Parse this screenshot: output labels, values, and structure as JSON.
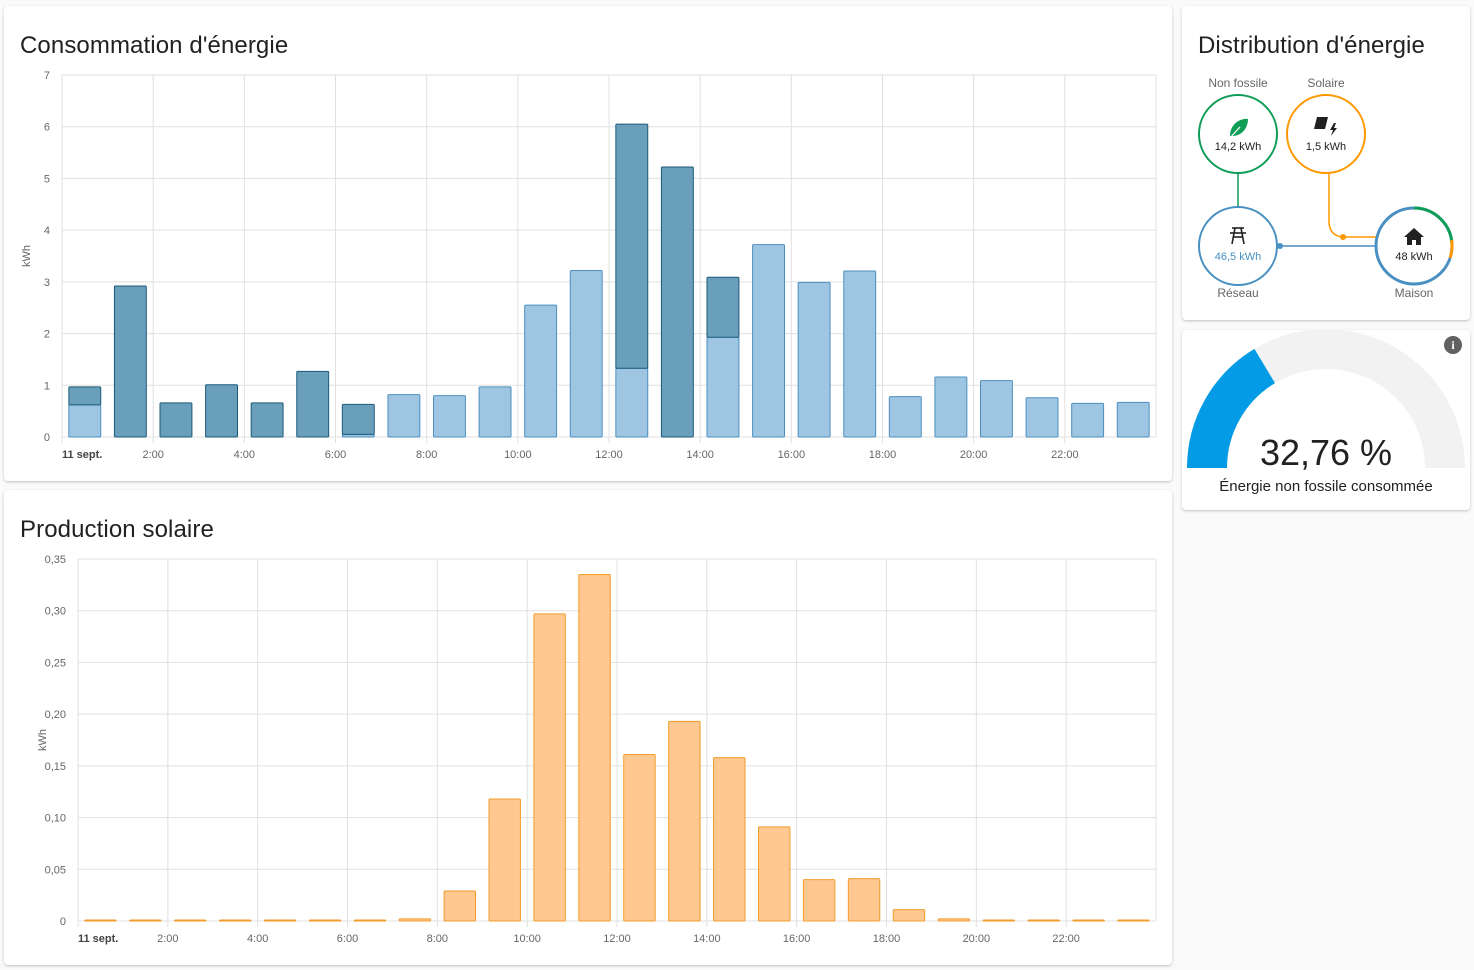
{
  "consumption_card": {
    "title": "Consommation d'énergie",
    "unit": "kWh"
  },
  "solar_card": {
    "title": "Production solaire",
    "unit": "kWh"
  },
  "distribution_card": {
    "title": "Distribution d'énergie",
    "non_fossil": {
      "label": "Non fossile",
      "value": "14,2 kWh"
    },
    "solar": {
      "label": "Solaire",
      "value": "1,5 kWh"
    },
    "grid": {
      "label": "Réseau",
      "value": "46,5 kWh"
    },
    "home": {
      "label": "Maison",
      "value": "48 kWh"
    }
  },
  "gauge_card": {
    "value": 32.76,
    "value_text": "32,76 %",
    "label": "Énergie non fossile consommée",
    "info_icon": "info-icon"
  },
  "colors": {
    "grid_dark": "#6a9fbb",
    "grid_dark_border": "#1d5a7a",
    "grid_light": "#9ec6e2",
    "grid_light_border": "#4d8fc0",
    "solar_fill": "#ffc890",
    "solar_border": "#f39c2c",
    "non_fossil": "#0f9d58",
    "solar_node": "#ff9800",
    "grid_node": "#488fc2",
    "gauge": "#039be5"
  },
  "chart_data": [
    {
      "type": "bar",
      "title": "Consommation d'énergie",
      "ylabel": "kWh",
      "ylim": [
        0,
        7
      ],
      "yticks": [
        "0",
        "1",
        "2",
        "3",
        "4",
        "5",
        "6",
        "7"
      ],
      "xticks": [
        "11 sept.",
        "2:00",
        "4:00",
        "6:00",
        "8:00",
        "10:00",
        "12:00",
        "14:00",
        "16:00",
        "18:00",
        "20:00",
        "22:00"
      ],
      "categories": [
        "0:00",
        "1:00",
        "2:00",
        "3:00",
        "4:00",
        "5:00",
        "6:00",
        "7:00",
        "8:00",
        "9:00",
        "10:00",
        "11:00",
        "12:00",
        "13:00",
        "14:00",
        "15:00",
        "16:00",
        "17:00",
        "18:00",
        "19:00",
        "20:00",
        "21:00",
        "22:00",
        "23:00"
      ],
      "series": [
        {
          "values": [
            0.62,
            0,
            0,
            0,
            0,
            0,
            0.05,
            0.82,
            0.8,
            0.97,
            2.55,
            3.22,
            1.33,
            0,
            1.93,
            3.72,
            2.99,
            3.21,
            0.78,
            1.16,
            1.09,
            0.76,
            0.65,
            0.67
          ]
        },
        {
          "values": [
            0.35,
            2.92,
            0.66,
            1.01,
            0.66,
            1.27,
            0.58,
            0,
            0,
            0,
            0,
            0,
            4.72,
            5.22,
            1.16,
            0,
            0,
            0,
            0,
            0,
            0,
            0,
            0,
            0
          ]
        }
      ],
      "grid": true
    },
    {
      "type": "bar",
      "title": "Production solaire",
      "ylabel": "kWh",
      "ylim": [
        0,
        0.35
      ],
      "yticks": [
        "0",
        "0,05",
        "0,10",
        "0,15",
        "0,20",
        "0,25",
        "0,30",
        "0,35"
      ],
      "xticks": [
        "11 sept.",
        "2:00",
        "4:00",
        "6:00",
        "8:00",
        "10:00",
        "12:00",
        "14:00",
        "16:00",
        "18:00",
        "20:00",
        "22:00"
      ],
      "categories": [
        "0:00",
        "1:00",
        "2:00",
        "3:00",
        "4:00",
        "5:00",
        "6:00",
        "7:00",
        "8:00",
        "9:00",
        "10:00",
        "11:00",
        "12:00",
        "13:00",
        "14:00",
        "15:00",
        "16:00",
        "17:00",
        "18:00",
        "19:00",
        "20:00",
        "21:00",
        "22:00",
        "23:00"
      ],
      "series": [
        {
          "values": [
            0.001,
            0.001,
            0.001,
            0.001,
            0.001,
            0.001,
            0.001,
            0.002,
            0.029,
            0.118,
            0.297,
            0.335,
            0.161,
            0.193,
            0.158,
            0.091,
            0.04,
            0.041,
            0.011,
            0.002,
            0.001,
            0.001,
            0.001,
            0.001
          ]
        }
      ],
      "grid": true
    }
  ]
}
